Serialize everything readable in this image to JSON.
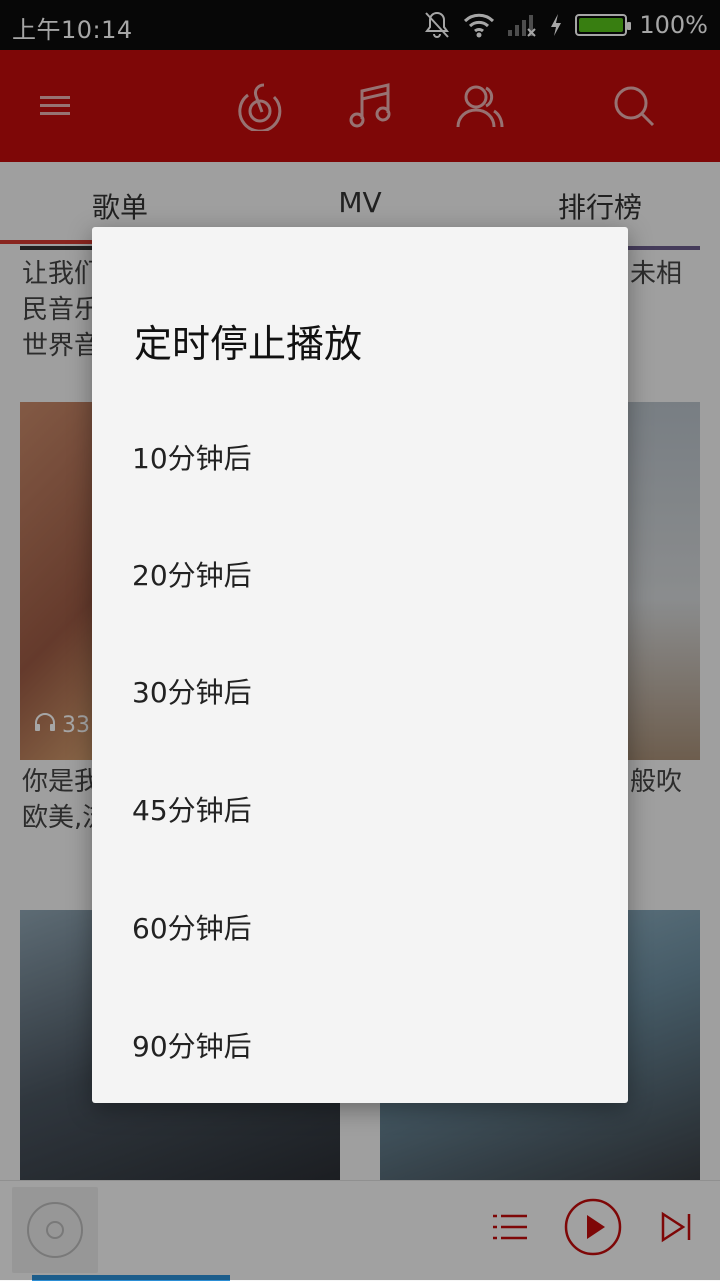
{
  "status_bar": {
    "time": "上午10:14",
    "battery_percent": "100%",
    "battery_level": 1.0,
    "battery_color": "#57c21b"
  },
  "header": {
    "background": "#c20c0c",
    "icons": [
      "menu-icon",
      "netease-logo-icon",
      "music-note-icon",
      "friends-icon",
      "search-icon"
    ]
  },
  "tabs": [
    "歌单",
    "MV",
    "排行榜"
  ],
  "background_content": {
    "text_rows": [
      {
        "left": "让我们",
        "right": "未相"
      },
      {
        "left": "民音乐",
        "right": ""
      },
      {
        "left": "世界音",
        "right": ""
      }
    ],
    "play_count_partial": "33",
    "caption_rows": [
      {
        "left": "你是我",
        "right": "般吹"
      },
      {
        "left": "欧美,流",
        "right": ""
      }
    ]
  },
  "dialog": {
    "title": "定时停止播放",
    "options": [
      "10分钟后",
      "20分钟后",
      "30分钟后",
      "45分钟后",
      "60分钟后",
      "90分钟后"
    ]
  },
  "player": {
    "accent": "#c20c0c",
    "controls": [
      "playlist-icon",
      "play-icon",
      "next-icon"
    ]
  }
}
